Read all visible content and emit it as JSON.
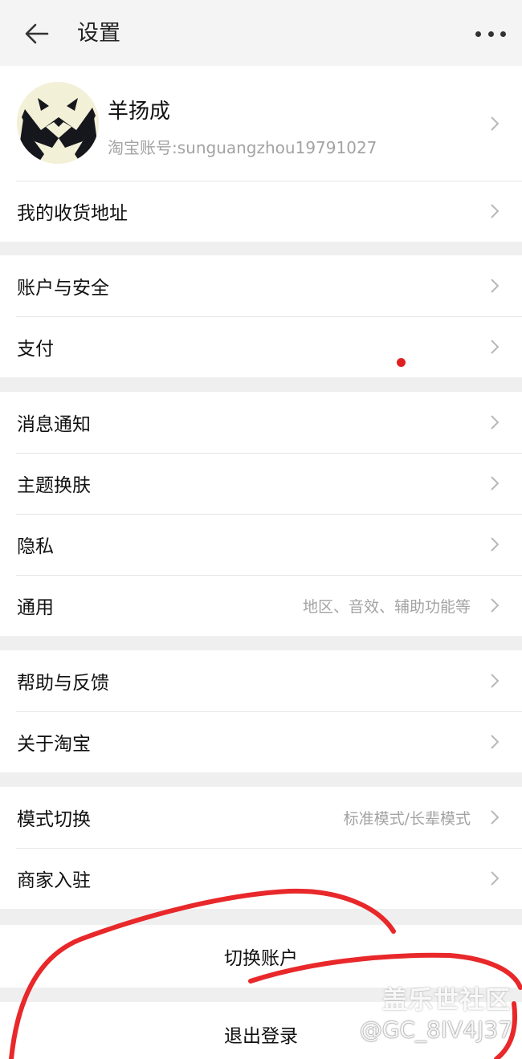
{
  "header": {
    "title": "设置",
    "back_icon": "arrow-left-icon",
    "more_icon": "more-dots-icon"
  },
  "profile": {
    "nickname": "羊扬成",
    "account": "淘宝账号:sunguangzhou19791027"
  },
  "groups": [
    {
      "items": [
        {
          "label": "我的收货地址"
        }
      ]
    },
    {
      "items": [
        {
          "label": "账户与安全"
        },
        {
          "label": "支付"
        }
      ]
    },
    {
      "items": [
        {
          "label": "消息通知"
        },
        {
          "label": "主题换肤"
        },
        {
          "label": "隐私"
        },
        {
          "label": "通用",
          "hint": "地区、音效、辅助功能等"
        }
      ]
    },
    {
      "items": [
        {
          "label": "帮助与反馈"
        },
        {
          "label": "关于淘宝"
        }
      ]
    },
    {
      "items": [
        {
          "label": "模式切换",
          "hint": "标准模式/长辈模式"
        },
        {
          "label": "商家入驻"
        }
      ]
    }
  ],
  "actions": {
    "switch_account": "切换账户",
    "logout": "退出登录"
  },
  "watermark": {
    "brand": "盖乐世社区",
    "user": "@GC_8IV4J37"
  },
  "colors": {
    "background": "#efefef",
    "card": "#ffffff",
    "hint": "#a3a3a3",
    "notification_dot": "#e02020",
    "scribble": "#e8282a"
  }
}
